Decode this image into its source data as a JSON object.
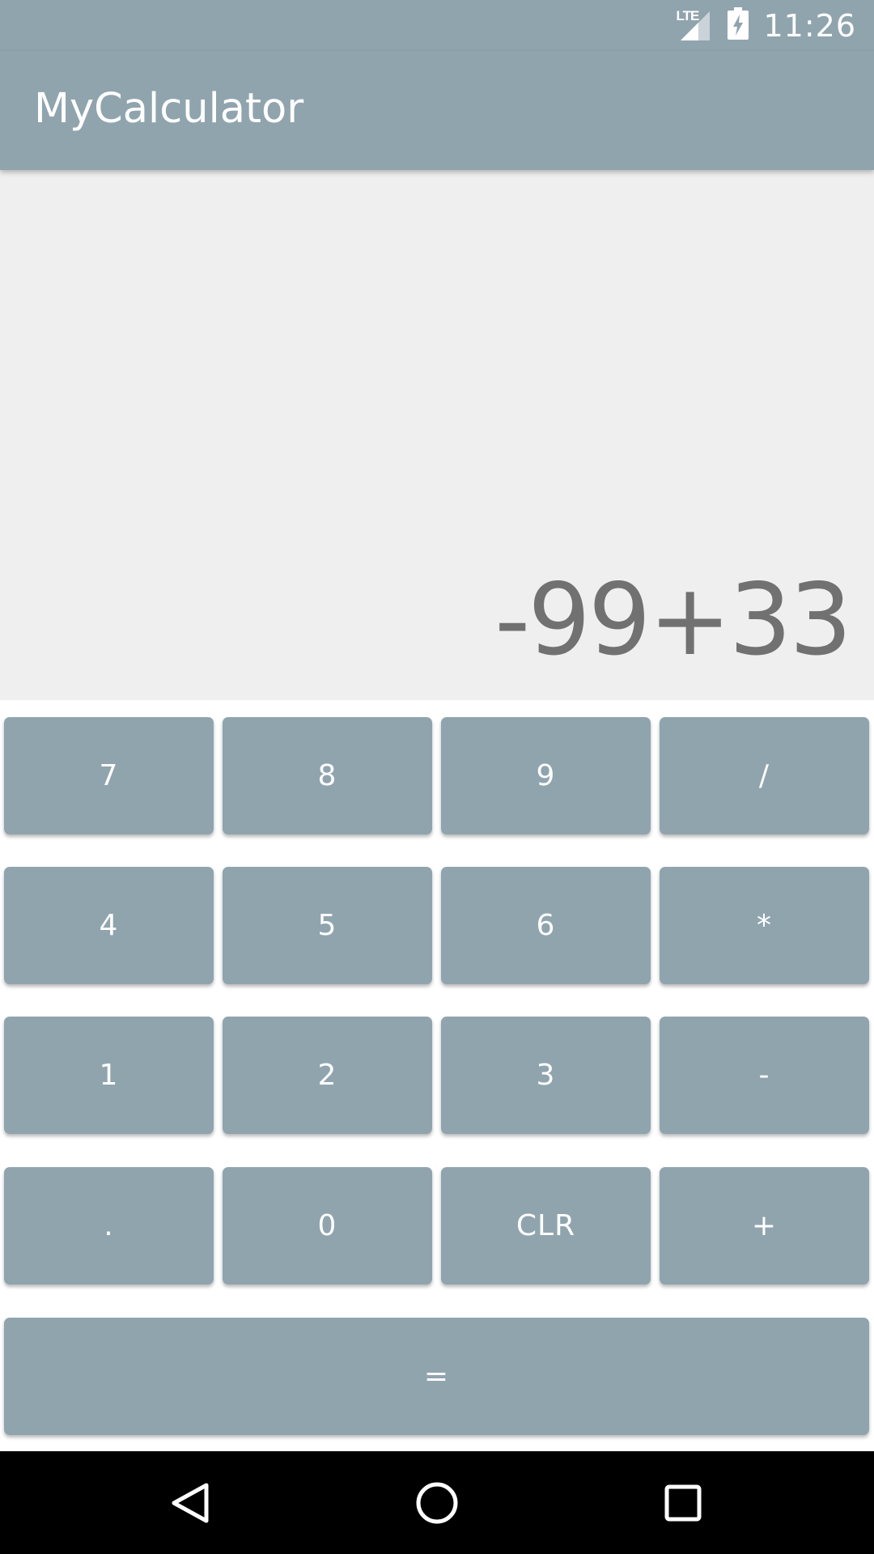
{
  "status_bar": {
    "network_label": "LTE",
    "time": "11:26",
    "icons": [
      "lte-signal-icon",
      "battery-charging-icon"
    ]
  },
  "app_bar": {
    "title": "MyCalculator"
  },
  "display": {
    "expression": "-99+33"
  },
  "keypad": {
    "rows": [
      [
        "7",
        "8",
        "9",
        "/"
      ],
      [
        "4",
        "5",
        "6",
        "*"
      ],
      [
        "1",
        "2",
        "3",
        "-"
      ],
      [
        ".",
        "0",
        "CLR",
        "+"
      ]
    ],
    "equals": "="
  },
  "nav_bar": {
    "icons": [
      "back-icon",
      "home-icon",
      "recent-apps-icon"
    ]
  },
  "colors": {
    "primary": "#90a4ae",
    "display_background": "#efefef",
    "expression_text": "#717171",
    "key_text": "#ffffff",
    "nav_background": "#000000"
  }
}
